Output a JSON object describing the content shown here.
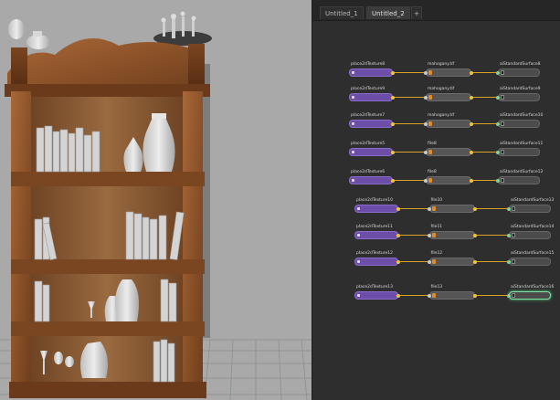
{
  "node_editor": {
    "tabs": [
      {
        "label": "Untitled_1",
        "active": false
      },
      {
        "label": "Untitled_2",
        "active": true
      },
      {
        "label": "+",
        "active": false
      }
    ],
    "rows": [
      {
        "place": "place2dTexture8",
        "file": "mahogany.tif",
        "shader": "aiStandardSurface8"
      },
      {
        "place": "place2dTexture9",
        "file": "mahogany.tif",
        "shader": "aiStandardSurface9"
      },
      {
        "place": "place2dTexture7",
        "file": "mahogany.tif",
        "shader": "aiStandardSurface10"
      },
      {
        "place": "place2dTexture5",
        "file": "file8",
        "shader": "aiStandardSurface11"
      },
      {
        "place": "place2dTexture6",
        "file": "file8",
        "shader": "aiStandardSurface12"
      },
      {
        "place": "place2dTexture10",
        "file": "file10",
        "shader": "aiStandardSurface13"
      },
      {
        "place": "place2dTexture11",
        "file": "file11",
        "shader": "aiStandardSurface14"
      },
      {
        "place": "place2dTexture12",
        "file": "file12",
        "shader": "aiStandardSurface15"
      },
      {
        "place": "place2dTexture13",
        "file": "file13",
        "shader": "aiStandardSurface16"
      }
    ],
    "selected_row": 8
  },
  "colors": {
    "viewport_bg": "#a9a9a9",
    "editor_bg": "#2e2e2e",
    "place_node": "#6c4ea8",
    "file_swatch": "#e08a2a",
    "connection": "#d6a324",
    "selected_outline": "#7ee3a4"
  }
}
